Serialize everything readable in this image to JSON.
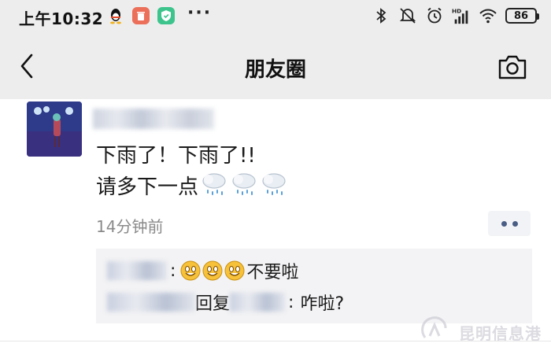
{
  "status_bar": {
    "time": "上午10:32",
    "more": "···",
    "battery": "86"
  },
  "navbar": {
    "title": "朋友圈",
    "back_icon": "chevron-left-icon",
    "camera_icon": "camera-icon"
  },
  "post": {
    "line1": "下雨了！下雨了!!",
    "line2": "请多下一点",
    "emoji": "rain-cloud-icon",
    "time_ago": "14分钟前"
  },
  "comments": [
    {
      "text": "不要啦"
    },
    {
      "reply_word": "回复",
      "text": "咋啦?"
    }
  ],
  "watermark": "昆明信息港",
  "colors": {
    "bar_bg": "#ededed",
    "accent": "#4a5d85"
  }
}
